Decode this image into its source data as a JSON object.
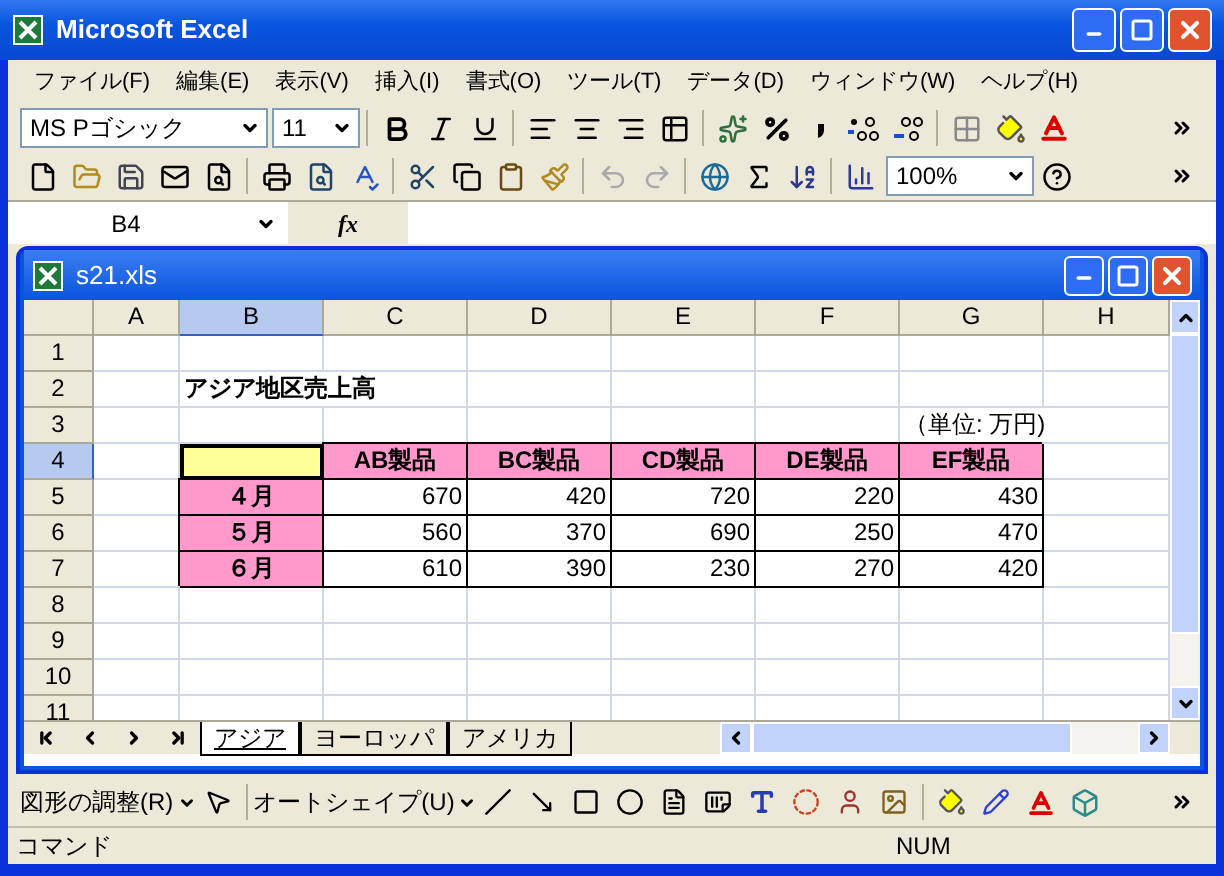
{
  "window": {
    "title": "Microsoft Excel"
  },
  "menu": [
    "ファイル(F)",
    "編集(E)",
    "表示(V)",
    "挿入(I)",
    "書式(O)",
    "ツール(T)",
    "データ(D)",
    "ウィンドウ(W)",
    "ヘルプ(H)"
  ],
  "format_toolbar": {
    "font": "MS Pゴシック",
    "size": "11"
  },
  "standard_toolbar": {
    "zoom": "100%"
  },
  "formula_bar": {
    "name_box": "B4",
    "fx_label": "fx"
  },
  "workbook": {
    "title": "s21.xls",
    "columns": [
      {
        "label": "A",
        "selected": false
      },
      {
        "label": "B",
        "selected": true
      },
      {
        "label": "C",
        "selected": false
      },
      {
        "label": "D",
        "selected": false
      },
      {
        "label": "E",
        "selected": false
      },
      {
        "label": "F",
        "selected": false
      },
      {
        "label": "G",
        "selected": false
      },
      {
        "label": "H",
        "selected": false
      }
    ],
    "rows": [
      {
        "number": "1",
        "selected": false,
        "cells": [
          {
            "kind": "empty"
          },
          {
            "kind": "empty"
          },
          {
            "kind": "empty"
          },
          {
            "kind": "empty"
          },
          {
            "kind": "empty"
          },
          {
            "kind": "empty"
          },
          {
            "kind": "empty"
          },
          {
            "kind": "empty"
          }
        ]
      },
      {
        "number": "2",
        "selected": false,
        "cells": [
          {
            "kind": "empty"
          },
          {
            "kind": "title",
            "text": "アジア地区売上高"
          },
          {
            "kind": "empty"
          },
          {
            "kind": "empty"
          },
          {
            "kind": "empty"
          },
          {
            "kind": "empty"
          },
          {
            "kind": "empty"
          },
          {
            "kind": "empty"
          }
        ]
      },
      {
        "number": "3",
        "selected": false,
        "cells": [
          {
            "kind": "empty"
          },
          {
            "kind": "empty"
          },
          {
            "kind": "empty"
          },
          {
            "kind": "empty"
          },
          {
            "kind": "empty"
          },
          {
            "kind": "empty"
          },
          {
            "kind": "note",
            "text": "（単位: 万円)"
          },
          {
            "kind": "empty"
          }
        ]
      },
      {
        "number": "4",
        "selected": true,
        "cells": [
          {
            "kind": "empty"
          },
          {
            "kind": "active"
          },
          {
            "kind": "header",
            "text": "AB製品"
          },
          {
            "kind": "header",
            "text": "BC製品"
          },
          {
            "kind": "header",
            "text": "CD製品"
          },
          {
            "kind": "header",
            "text": "DE製品"
          },
          {
            "kind": "header",
            "text": "EF製品"
          },
          {
            "kind": "empty"
          }
        ]
      },
      {
        "number": "5",
        "selected": false,
        "cells": [
          {
            "kind": "empty"
          },
          {
            "kind": "label",
            "text": "４月"
          },
          {
            "kind": "number",
            "text": "670"
          },
          {
            "kind": "number",
            "text": "420"
          },
          {
            "kind": "number",
            "text": "720"
          },
          {
            "kind": "number",
            "text": "220"
          },
          {
            "kind": "number",
            "text": "430"
          },
          {
            "kind": "empty"
          }
        ]
      },
      {
        "number": "6",
        "selected": false,
        "cells": [
          {
            "kind": "empty"
          },
          {
            "kind": "label",
            "text": "５月"
          },
          {
            "kind": "number",
            "text": "560"
          },
          {
            "kind": "number",
            "text": "370"
          },
          {
            "kind": "number",
            "text": "690"
          },
          {
            "kind": "number",
            "text": "250"
          },
          {
            "kind": "number",
            "text": "470"
          },
          {
            "kind": "empty"
          }
        ]
      },
      {
        "number": "7",
        "selected": false,
        "cells": [
          {
            "kind": "empty"
          },
          {
            "kind": "label",
            "text": "６月"
          },
          {
            "kind": "number",
            "text": "610"
          },
          {
            "kind": "number",
            "text": "390"
          },
          {
            "kind": "number",
            "text": "230"
          },
          {
            "kind": "number",
            "text": "270"
          },
          {
            "kind": "number",
            "text": "420"
          },
          {
            "kind": "empty"
          }
        ]
      },
      {
        "number": "8",
        "selected": false,
        "cells": [
          {
            "kind": "empty"
          },
          {
            "kind": "empty"
          },
          {
            "kind": "empty"
          },
          {
            "kind": "empty"
          },
          {
            "kind": "empty"
          },
          {
            "kind": "empty"
          },
          {
            "kind": "empty"
          },
          {
            "kind": "empty"
          }
        ]
      },
      {
        "number": "9",
        "selected": false,
        "cells": [
          {
            "kind": "empty"
          },
          {
            "kind": "empty"
          },
          {
            "kind": "empty"
          },
          {
            "kind": "empty"
          },
          {
            "kind": "empty"
          },
          {
            "kind": "empty"
          },
          {
            "kind": "empty"
          },
          {
            "kind": "empty"
          }
        ]
      },
      {
        "number": "10",
        "selected": false,
        "cells": [
          {
            "kind": "empty"
          },
          {
            "kind": "empty"
          },
          {
            "kind": "empty"
          },
          {
            "kind": "empty"
          },
          {
            "kind": "empty"
          },
          {
            "kind": "empty"
          },
          {
            "kind": "empty"
          },
          {
            "kind": "empty"
          }
        ]
      },
      {
        "number": "11",
        "selected": false,
        "cells": [
          {
            "kind": "empty"
          },
          {
            "kind": "empty"
          },
          {
            "kind": "empty"
          },
          {
            "kind": "empty"
          },
          {
            "kind": "empty"
          },
          {
            "kind": "empty"
          },
          {
            "kind": "empty"
          },
          {
            "kind": "empty"
          }
        ]
      }
    ],
    "sheet_tabs": [
      {
        "label": "アジア",
        "selected": true
      },
      {
        "label": "ヨーロッパ",
        "selected": false
      },
      {
        "label": "アメリカ",
        "selected": false
      }
    ]
  },
  "drawing_toolbar": {
    "draw_menu": "図形の調整(R)",
    "autoshape_menu": "オートシェイプ(U)"
  },
  "status_bar": {
    "mode": "コマンド",
    "num": "NUM"
  }
}
